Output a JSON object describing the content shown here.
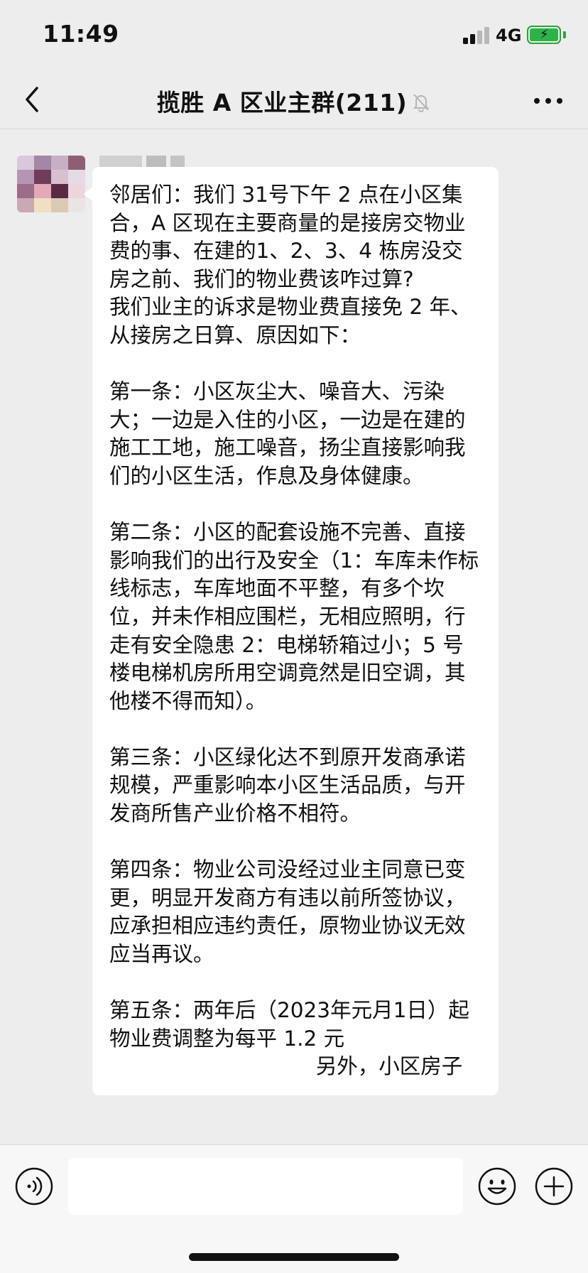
{
  "status_bar": {
    "time": "11:49",
    "network": "4G"
  },
  "nav": {
    "title": "揽胜 A 区业主群(211)",
    "back_icon": "chevron-left-icon",
    "mute_icon": "bell-muted-icon",
    "more_icon": "more-dots-icon"
  },
  "message": {
    "text": "邻居们：我们 31号下午 2 点在小区集合，A 区现在主要商量的是接房交物业费的事、在建的1、2、3、4 栋房没交房之前、我们的物业费该咋过算?\n我们业主的诉求是物业费直接免 2 年、从接房之日算、原因如下：\n\n第一条：小区灰尘大、噪音大、污染大；一边是入住的小区，一边是在建的施工工地，施工噪音，扬尘直接影响我们的小区生活，作息及身体健康。\n\n第二条：小区的配套设施不完善、直接影响我们的出行及安全（1：车库未作标线标志，车库地面不平整，有多个坎位，并未作相应围栏，无相应照明，行走有安全隐患 2：电梯轿箱过小；5 号楼电梯机房所用空调竟然是旧空调，其他楼不得而知）。\n\n第三条：小区绿化达不到原开发商承诺规模，严重影响本小区生活品质，与开发商所售产业价格不相符。\n\n第四条：物业公司没经过业主同意已变更，明显开发商方有违以前所签协议，应承担相应违约责任，原物业协议无效应当再议。\n\n第五条：两年后（2023年元月1日）起物业费调整为每平 1.2 元\n                               另外，小区房子"
  },
  "input_bar": {
    "voice_icon": "voice-icon",
    "emoji_icon": "emoji-icon",
    "plus_icon": "plus-icon",
    "placeholder": ""
  },
  "colors": {
    "background": "#ededed",
    "bubble": "#ffffff",
    "battery": "#2bb34a"
  }
}
